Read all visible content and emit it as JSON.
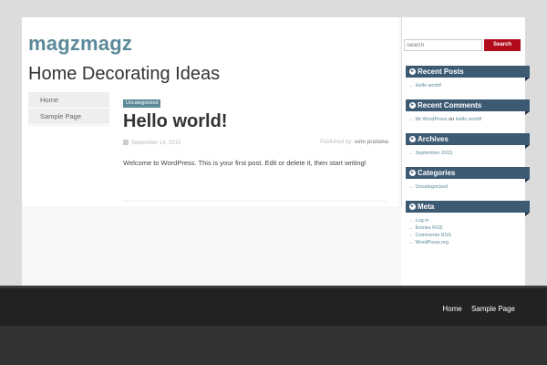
{
  "site": {
    "title": "magzmagz",
    "description": "Home Decorating Ideas"
  },
  "side_nav": [
    "Home",
    "Sample Page"
  ],
  "post": {
    "category": "Uncategorized",
    "title": "Hello world!",
    "date": "September 14, 2015",
    "byline_prefix": "Published by:",
    "author": "seto pratama",
    "body": "Welcome to WordPress. This is your first post. Edit or delete it, then start writing!"
  },
  "search": {
    "placeholder": "Search",
    "button": "Search"
  },
  "widgets": {
    "recent_posts": {
      "title": "Recent Posts",
      "items": [
        "Hello world!"
      ]
    },
    "recent_comments": {
      "title": "Recent Comments",
      "author": "Mr WordPress",
      "on": "on",
      "post": "Hello world!"
    },
    "archives": {
      "title": "Archives",
      "items": [
        "September 2015"
      ]
    },
    "categories": {
      "title": "Categories",
      "items": [
        "Uncategorized"
      ]
    },
    "meta": {
      "title": "Meta",
      "items": [
        "Log in",
        "Entries RSS",
        "Comments RSS",
        "WordPress.org"
      ]
    }
  },
  "footer_nav": [
    "Home",
    "Sample Page"
  ],
  "colors": {
    "accent": "#5b8a9a",
    "widget_header": "#3d5a73",
    "search_button": "#b20c1c",
    "footer": "#222222"
  },
  "icons": {
    "widget_icon": "circle-arrow-right-icon",
    "date_icon": "calendar-icon"
  }
}
